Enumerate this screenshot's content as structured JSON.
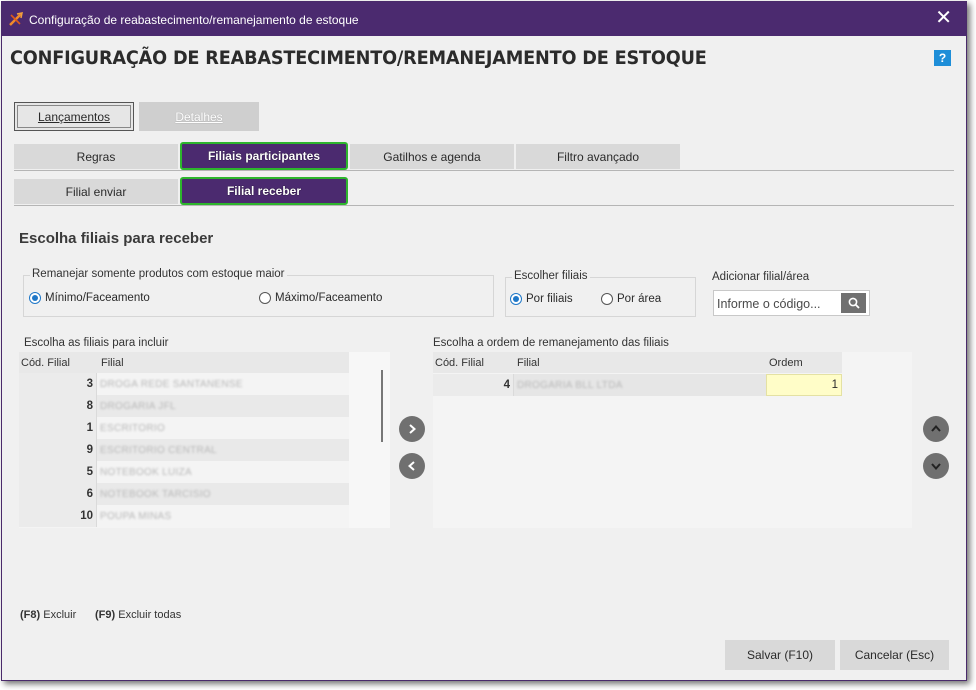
{
  "window": {
    "title": "Configuração de reabastecimento/remanejamento de estoque",
    "close_glyph": "✕"
  },
  "header": {
    "title": "CONFIGURAÇÃO DE REABASTECIMENTO/REMANEJAMENTO DE ESTOQUE",
    "help_glyph": "?"
  },
  "main_tabs": [
    {
      "label": "Lançamentos",
      "selected": true
    },
    {
      "label": "Detalhes",
      "selected": false
    }
  ],
  "sub_tabs": [
    {
      "label": "Regras"
    },
    {
      "label": "Filiais participantes",
      "active": true
    },
    {
      "label": "Gatilhos e agenda"
    },
    {
      "label": "Filtro avançado"
    }
  ],
  "inner_tabs": [
    {
      "label": "Filial enviar"
    },
    {
      "label": "Filial receber",
      "active": true
    }
  ],
  "section_title": "Escolha filiais para receber",
  "remanejar_group": {
    "label": "Remanejar somente produtos com estoque maior",
    "options": [
      {
        "label": "Mínimo/Faceamento",
        "checked": true
      },
      {
        "label": "Máximo/Faceamento",
        "checked": false
      }
    ]
  },
  "escolher_group": {
    "label": "Escolher filiais",
    "options": [
      {
        "label": "Por filiais",
        "checked": true
      },
      {
        "label": "Por área",
        "checked": false
      }
    ]
  },
  "add_filial": {
    "label": "Adicionar filial/área",
    "placeholder": "Informe o código..."
  },
  "left_grid": {
    "caption": "Escolha as filiais para incluir",
    "headers": [
      "Cód. Filial",
      "Filial"
    ],
    "rows": [
      {
        "code": "3",
        "name": "DROGA REDE SANTANENSE"
      },
      {
        "code": "8",
        "name": "DROGARIA JFL"
      },
      {
        "code": "1",
        "name": "ESCRITORIO"
      },
      {
        "code": "9",
        "name": "ESCRITORIO CENTRAL"
      },
      {
        "code": "5",
        "name": "NOTEBOOK LUIZA"
      },
      {
        "code": "6",
        "name": "NOTEBOOK TARCISIO"
      },
      {
        "code": "10",
        "name": "POUPA MINAS"
      }
    ]
  },
  "right_grid": {
    "caption": "Escolha a ordem de remanejamento das filiais",
    "headers": [
      "Cód. Filial",
      "Filial",
      "Ordem"
    ],
    "rows": [
      {
        "code": "4",
        "name": "DROGARIA BLL LTDA",
        "order": "1"
      }
    ]
  },
  "shortcuts": [
    {
      "key": "(F8)",
      "label": "Excluir"
    },
    {
      "key": "(F9)",
      "label": "Excluir todas"
    }
  ],
  "buttons": {
    "save": "Salvar (F10)",
    "cancel": "Cancelar (Esc)"
  },
  "colors": {
    "titlebar": "#4b2a6f",
    "active_tab": "#4b2a6f",
    "active_tab_border": "#2db52d",
    "radio_checked": "#1f78c8",
    "order_cell": "#fffdc8"
  }
}
